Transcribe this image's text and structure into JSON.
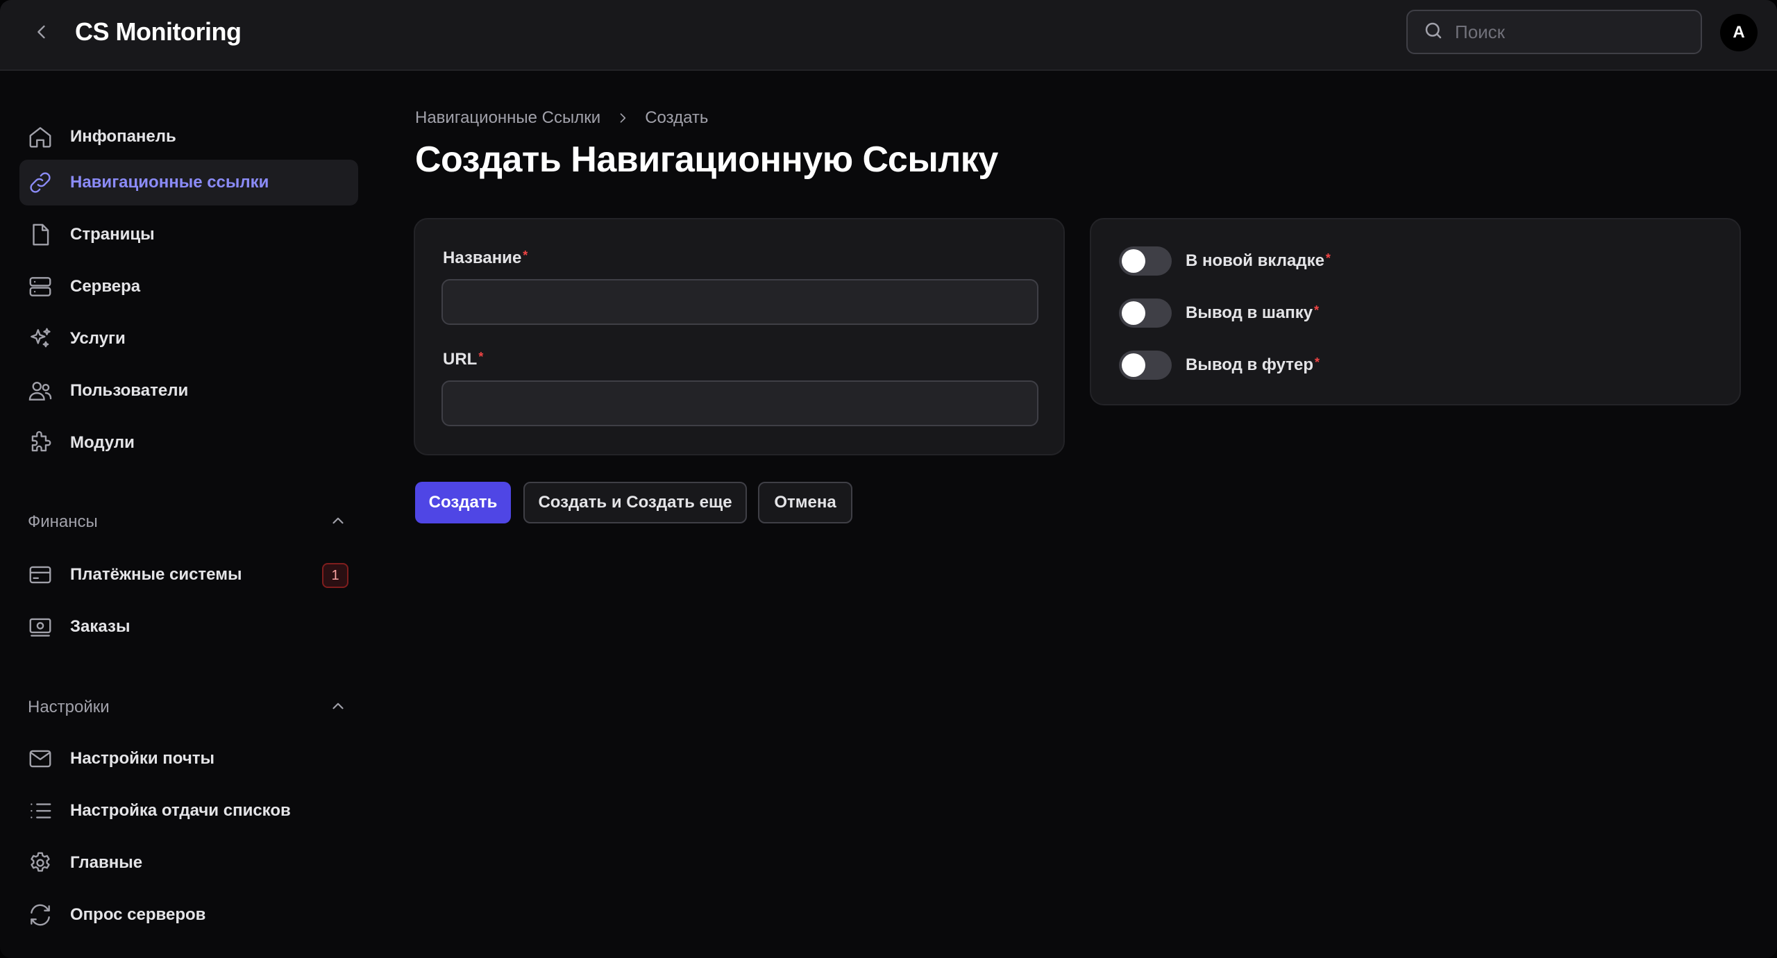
{
  "header": {
    "title": "CS Monitoring",
    "search_placeholder": "Поиск",
    "avatar_initial": "A"
  },
  "sidebar": {
    "items": [
      {
        "label": "Инфопанель",
        "icon": "home-icon"
      },
      {
        "label": "Навигационные ссылки",
        "icon": "link-icon",
        "active": true
      },
      {
        "label": "Страницы",
        "icon": "document-icon"
      },
      {
        "label": "Сервера",
        "icon": "server-icon"
      },
      {
        "label": "Услуги",
        "icon": "sparkles-icon"
      },
      {
        "label": "Пользователи",
        "icon": "users-icon"
      },
      {
        "label": "Модули",
        "icon": "puzzle-icon"
      }
    ],
    "groups": [
      {
        "label": "Финансы",
        "items": [
          {
            "label": "Платёжные системы",
            "icon": "credit-card-icon",
            "badge": "1"
          },
          {
            "label": "Заказы",
            "icon": "banknotes-icon"
          }
        ]
      },
      {
        "label": "Настройки",
        "items": [
          {
            "label": "Настройки почты",
            "icon": "envelope-icon"
          },
          {
            "label": "Настройка отдачи списков",
            "icon": "list-icon"
          },
          {
            "label": "Главные",
            "icon": "gear-icon"
          },
          {
            "label": "Опрос серверов",
            "icon": "refresh-icon"
          }
        ]
      }
    ]
  },
  "breadcrumb": {
    "items": [
      "Навигационные Ссылки",
      "Создать"
    ]
  },
  "page": {
    "title": "Создать Навигационную Ссылку"
  },
  "form": {
    "fields": [
      {
        "label": "Название",
        "required": true,
        "value": "",
        "placeholder": ""
      },
      {
        "label": "URL",
        "required": true,
        "value": "",
        "placeholder": ""
      }
    ],
    "toggles": [
      {
        "label": "В новой вкладке",
        "required": true,
        "checked": false
      },
      {
        "label": "Вывод в шапку",
        "required": true,
        "checked": false
      },
      {
        "label": "Вывод в футер",
        "required": true,
        "checked": false
      }
    ],
    "required_mark": "*"
  },
  "actions": {
    "create": "Создать",
    "create_another": "Создать и Создать еще",
    "cancel": "Отмена"
  },
  "colors": {
    "accent": "#4f46e5",
    "active_nav_text": "#8b8bf7",
    "required": "#ef4444",
    "background": "#09090b",
    "surface": "#18181b"
  }
}
